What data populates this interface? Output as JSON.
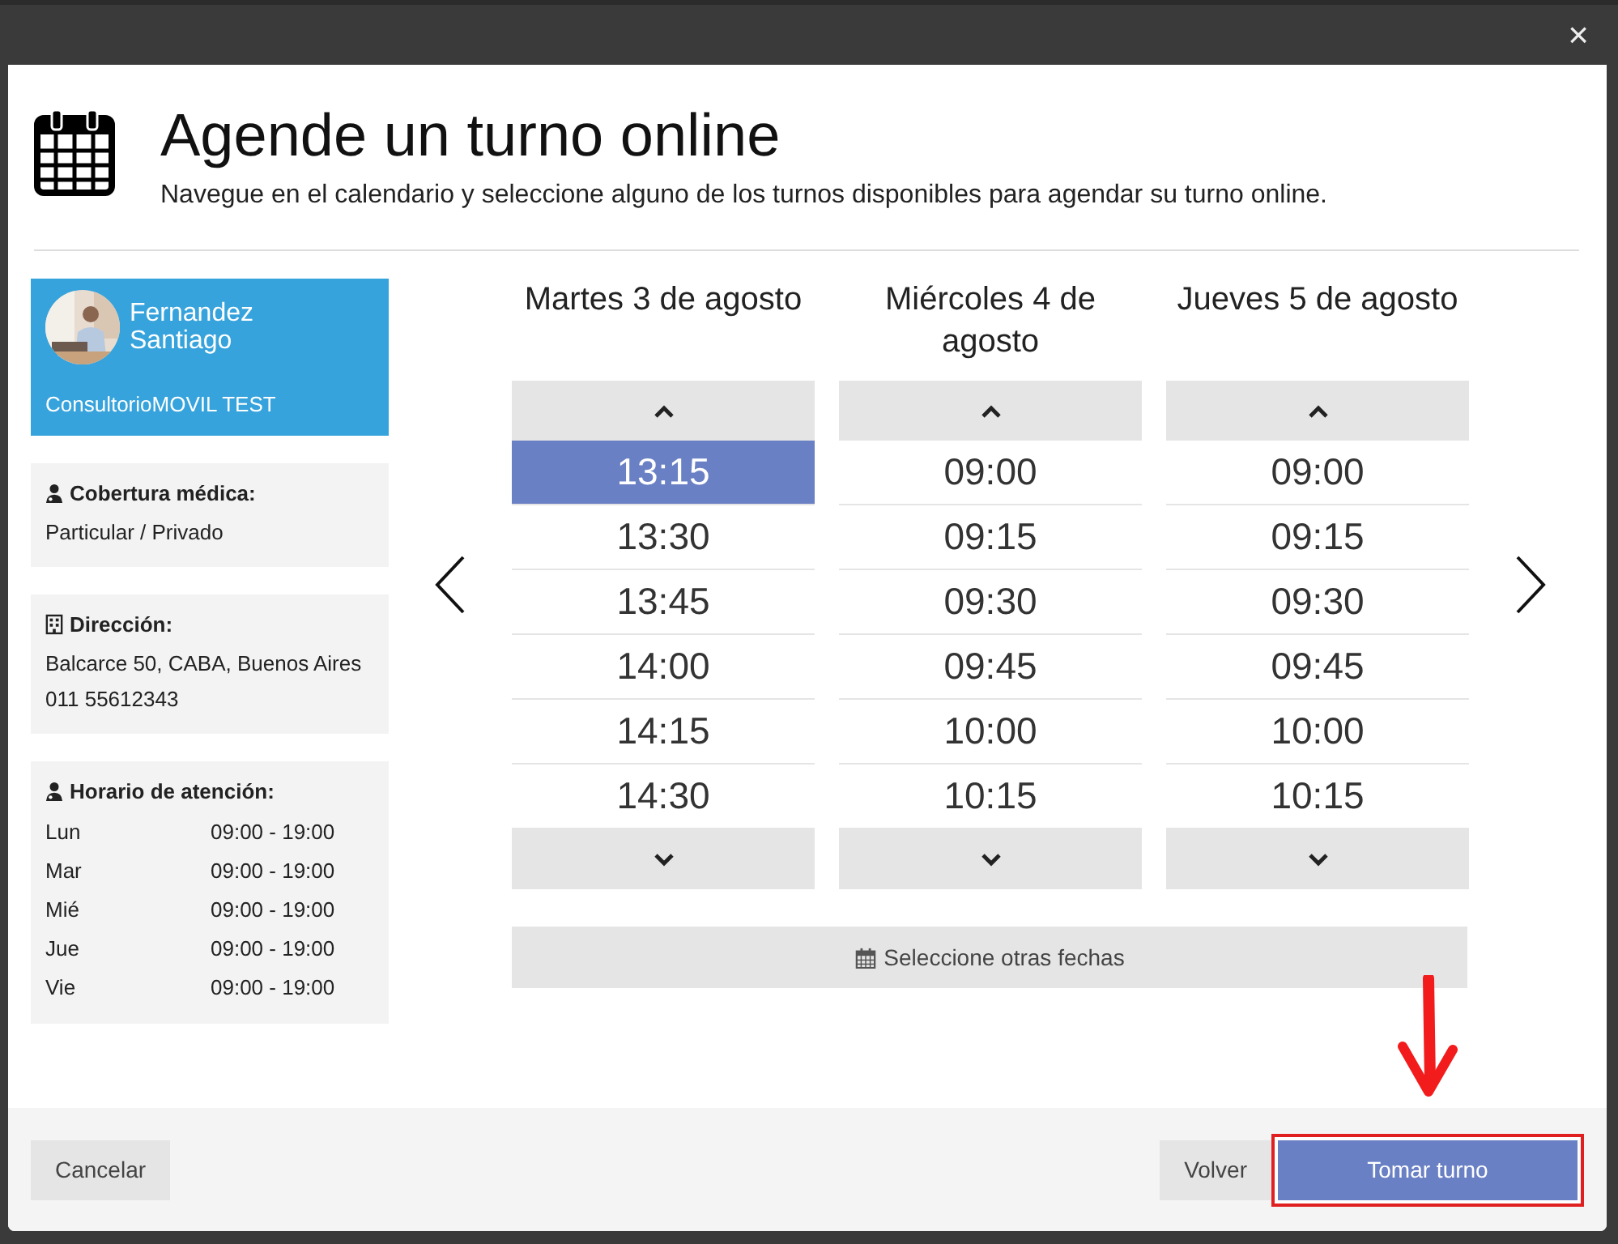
{
  "dialog": {
    "title": "Agende un turno online",
    "subtitle": "Navegue en el calendario y seleccione alguno de los turnos disponibles para agendar su turno online.",
    "close": "×"
  },
  "professional": {
    "name": "Fernandez Santiago",
    "office": "ConsultorioMOVIL TEST"
  },
  "info_cards": [
    {
      "kind": "coverage",
      "label": "Cobertura médica:",
      "lines": [
        "Particular / Privado"
      ]
    },
    {
      "kind": "address",
      "label": "Dirección:",
      "lines": [
        "Balcarce 50, CABA, Buenos Aires",
        "011 55612343"
      ]
    },
    {
      "kind": "hours",
      "label": "Horario de atención:",
      "schedule": [
        {
          "day": "Lun",
          "hours": "09:00 - 19:00"
        },
        {
          "day": "Mar",
          "hours": "09:00 - 19:00"
        },
        {
          "day": "Mié",
          "hours": "09:00 - 19:00"
        },
        {
          "day": "Jue",
          "hours": "09:00 - 19:00"
        },
        {
          "day": "Vie",
          "hours": "09:00 - 19:00"
        }
      ]
    }
  ],
  "days": [
    {
      "title": "Martes 3 de agosto",
      "slots": [
        {
          "time": "13:15",
          "selected": true
        },
        {
          "time": "13:30",
          "selected": false
        },
        {
          "time": "13:45",
          "selected": false
        },
        {
          "time": "14:00",
          "selected": false
        },
        {
          "time": "14:15",
          "selected": false
        },
        {
          "time": "14:30",
          "selected": false
        }
      ]
    },
    {
      "title": "Miércoles 4 de agosto",
      "slots": [
        {
          "time": "09:00",
          "selected": false
        },
        {
          "time": "09:15",
          "selected": false
        },
        {
          "time": "09:30",
          "selected": false
        },
        {
          "time": "09:45",
          "selected": false
        },
        {
          "time": "10:00",
          "selected": false
        },
        {
          "time": "10:15",
          "selected": false
        }
      ]
    },
    {
      "title": "Jueves 5 de agosto",
      "slots": [
        {
          "time": "09:00",
          "selected": false
        },
        {
          "time": "09:15",
          "selected": false
        },
        {
          "time": "09:30",
          "selected": false
        },
        {
          "time": "09:45",
          "selected": false
        },
        {
          "time": "10:00",
          "selected": false
        },
        {
          "time": "10:15",
          "selected": false
        }
      ]
    }
  ],
  "other_dates_button": "Seleccione otras fechas",
  "footer": {
    "cancel": "Cancelar",
    "back": "Volver",
    "confirm": "Tomar turno",
    "confirm_highlighted": true
  }
}
